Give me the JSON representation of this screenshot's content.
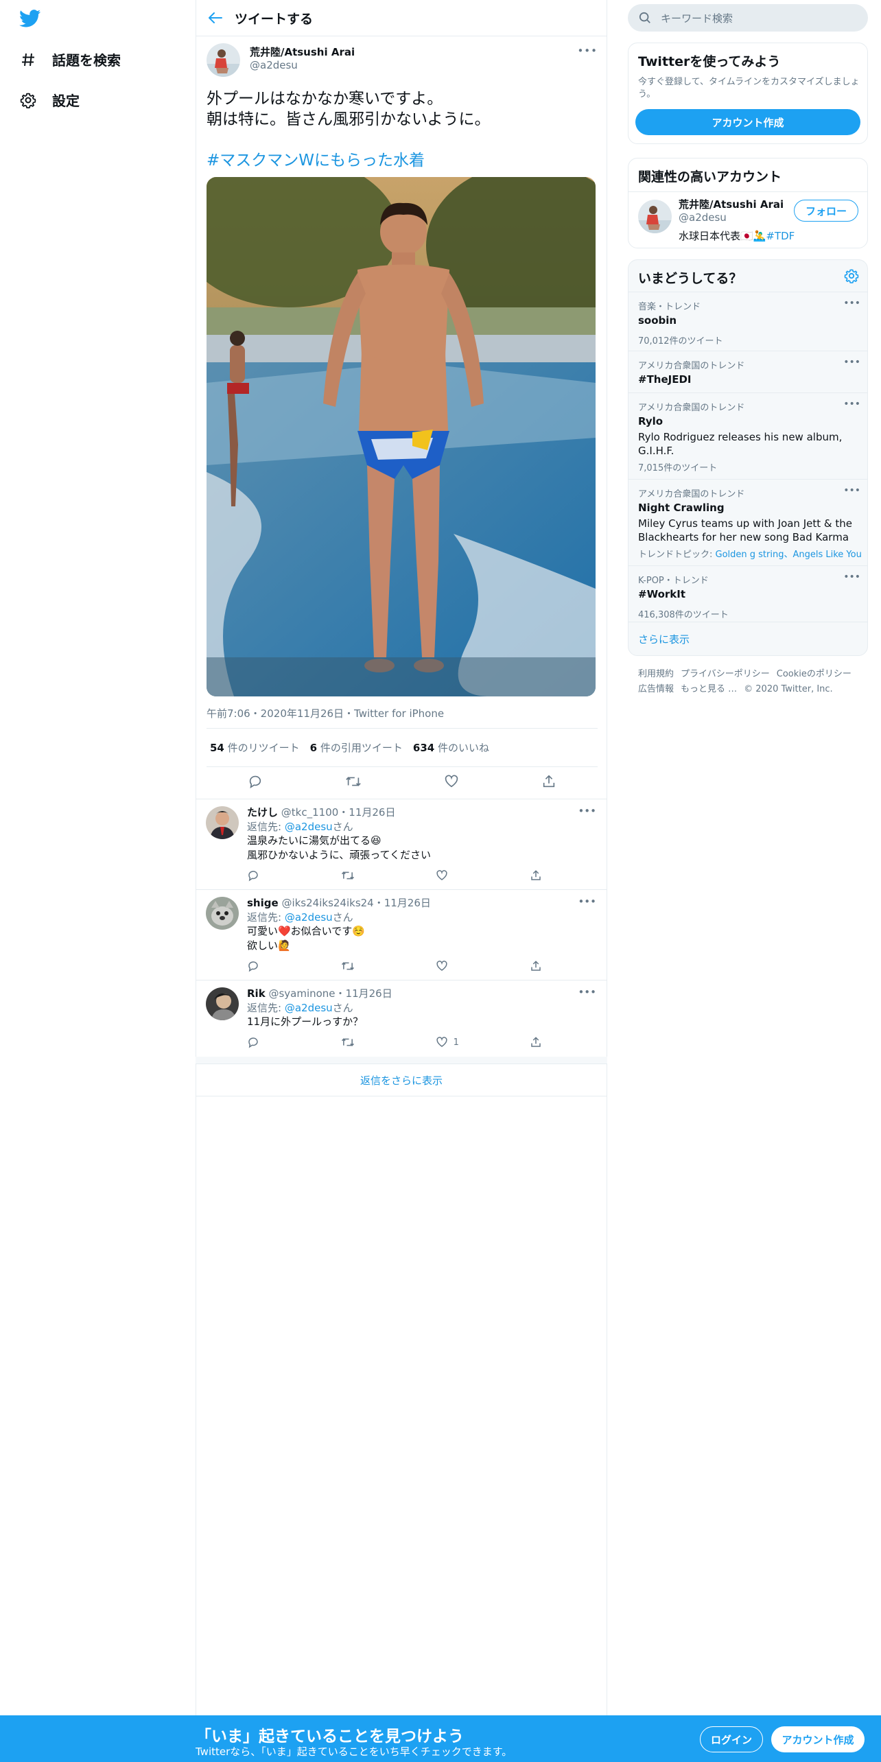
{
  "nav": {
    "items": [
      {
        "label": "話題を検索",
        "icon": "hashtag-icon"
      },
      {
        "label": "設定",
        "icon": "gear-icon"
      }
    ]
  },
  "header": {
    "title": "ツイートする"
  },
  "tweet": {
    "author_name": "荒井陸/Atsushi Arai",
    "author_handle": "@a2desu",
    "text_line1": "外プールはなかなか寒いですよ。",
    "text_line2": "朝は特に。皆さん風邪引かないように。",
    "hashtag": "#マスクマンWにもらった水着",
    "timestamp": "午前7:06・2020年11月26日・Twitter for iPhone",
    "retweets": "54",
    "retweets_label": "件のリツイート",
    "quotes": "6",
    "quotes_label": "件の引用ツイート",
    "likes": "634",
    "likes_label": "件のいいね"
  },
  "replies": [
    {
      "name": "たけし",
      "handle": "@tkc_1100・11月26日",
      "reply_to_prefix": "返信先: ",
      "reply_to": "@a2desu",
      "reply_to_suffix": "さん",
      "line1": "温泉みたいに湯気が出てる😆",
      "line2": "風邪ひかないように、頑張ってください",
      "like_count": ""
    },
    {
      "name": "shige",
      "handle": "@iks24iks24iks24・11月26日",
      "reply_to_prefix": "返信先: ",
      "reply_to": "@a2desu",
      "reply_to_suffix": "さん",
      "line1": "可愛い❤️お似合いです☺️",
      "line2": "欲しい🙋",
      "like_count": ""
    },
    {
      "name": "Rik",
      "handle": "@syaminone・11月26日",
      "reply_to_prefix": "返信先: ",
      "reply_to": "@a2desu",
      "reply_to_suffix": "さん",
      "line1": "11月に外プールっすか？",
      "line2": "",
      "like_count": "1"
    }
  ],
  "show_more_replies": "返信をさらに表示",
  "sidebar": {
    "search_placeholder": "キーワード検索",
    "signup": {
      "title": "Twitterを使ってみよう",
      "text_line1": "今すぐ登録して、タイムラインをカスタマイズしましょ",
      "text_line2": "う。",
      "button": "アカウント作成"
    },
    "related": {
      "title": "関連性の高いアカウント",
      "name": "荒井陸/Atsushi Arai",
      "handle": "@a2desu",
      "bio": "水球日本代表🇯🇵🤽‍♂️",
      "bio_tag": "#TDF",
      "follow": "フォロー"
    },
    "trends": {
      "title": "いまどうしてる？",
      "items": [
        {
          "category": "音楽・トレンド",
          "name": "soobin",
          "desc": "",
          "desc2": "",
          "count": "70,012件のツイート",
          "topic_label": "",
          "topics": ""
        },
        {
          "category": "アメリカ合衆国のトレンド",
          "name": "#TheJEDI",
          "desc": "",
          "desc2": "",
          "count": "",
          "topic_label": "",
          "topics": ""
        },
        {
          "category": "アメリカ合衆国のトレンド",
          "name": "Rylo",
          "desc": "Rylo Rodriguez releases his new album,",
          "desc2": "G.I.H.F.",
          "count": "7,015件のツイート",
          "topic_label": "",
          "topics": ""
        },
        {
          "category": "アメリカ合衆国のトレンド",
          "name": "Night Crawling",
          "desc": "Miley Cyrus teams up with Joan Jett & the",
          "desc2": "Blackhearts for her new song Bad Karma",
          "count": "",
          "topic_label": "トレンドトピック: ",
          "topics": "Golden g string、Angels Like You"
        },
        {
          "category": "K-POP・トレンド",
          "name": "#WorkIt",
          "desc": "",
          "desc2": "",
          "count": "416,308件のツイート",
          "topic_label": "",
          "topics": ""
        }
      ],
      "show_more": "さらに表示"
    },
    "footer_line1": [
      "利用規約",
      "プライバシーポリシー",
      "Cookieのポリシー"
    ],
    "footer_line2": [
      "広告情報",
      "もっと見る …",
      "© 2020 Twitter, Inc."
    ]
  },
  "banner": {
    "title": "「いま」起きていることを見つけよう",
    "subtitle": "Twitterなら、「いま」起きていることをいち早くチェックできます。",
    "login": "ログイン",
    "signup": "アカウント作成"
  },
  "colors": {
    "accent": "#1da1f2",
    "link": "#1b95e0",
    "secondary_text": "#657786",
    "border": "#e6ecf0"
  }
}
